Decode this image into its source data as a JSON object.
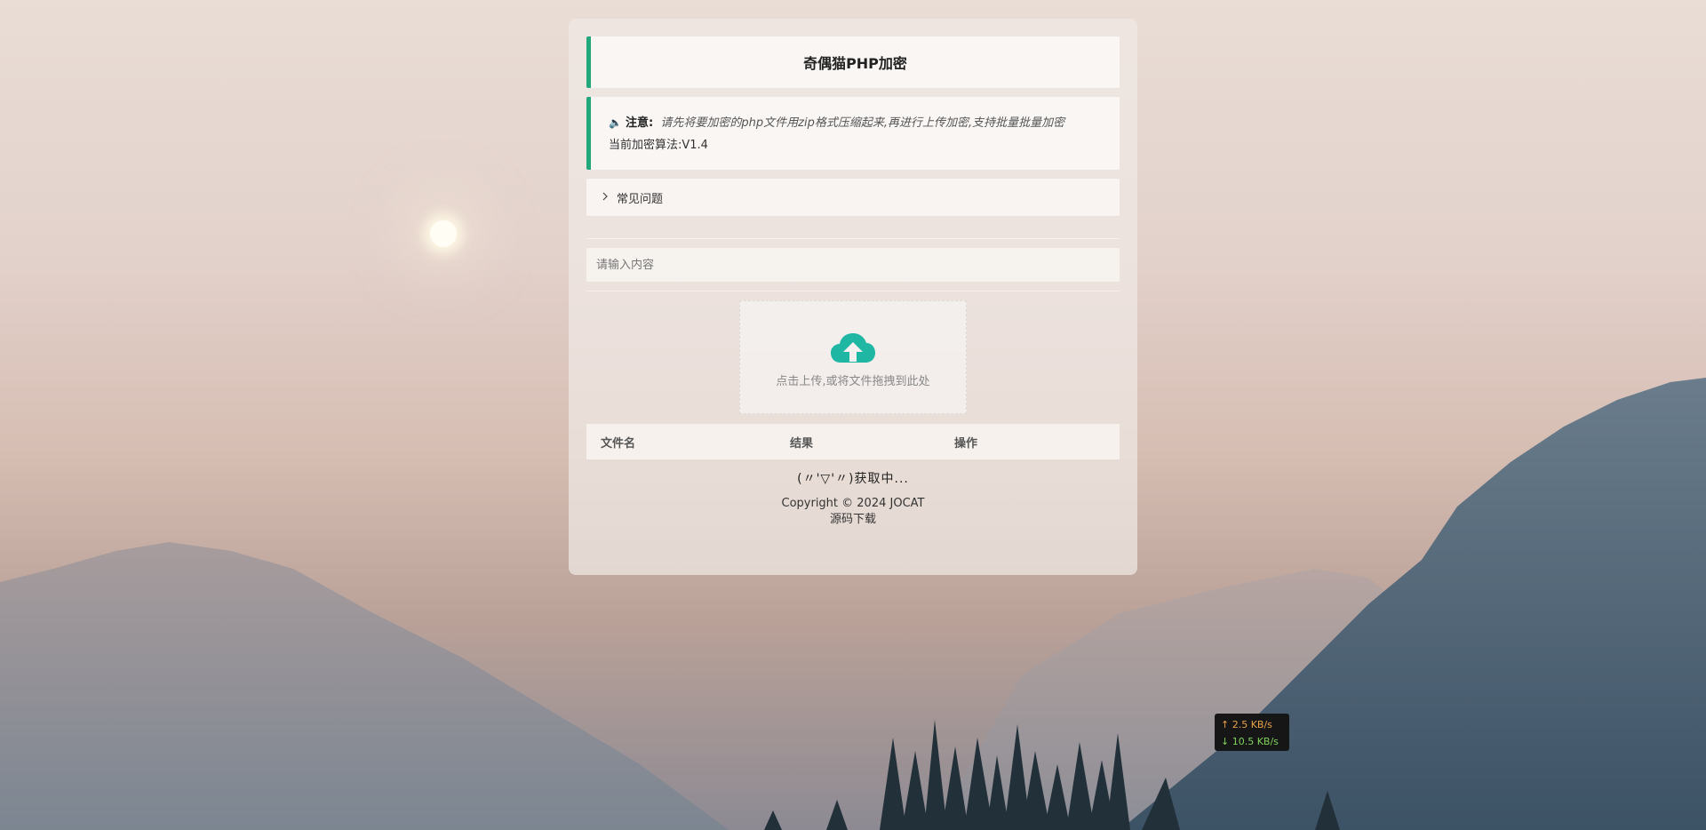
{
  "page": {
    "title": "奇偶猫PHP加密"
  },
  "notice": {
    "speaker_icon": "speaker-icon",
    "label": "注意:",
    "message": "请先将要加密的php文件用zip格式压缩起来,再进行上传加密,支持批量批量加密",
    "algorithm_label": "当前加密算法:",
    "algorithm_version": "V1.4"
  },
  "faq": {
    "label": "常见问题"
  },
  "search": {
    "placeholder": "请输入内容",
    "value": ""
  },
  "upload": {
    "hint": "点击上传,或将文件拖拽到此处",
    "icon_color": "#1fb7a4"
  },
  "table": {
    "columns": [
      "文件名",
      "结果",
      "操作"
    ]
  },
  "status": {
    "loading_text": "(〃'▽'〃)获取中..."
  },
  "footer": {
    "copyright": "Copyright © 2024 JOCAT",
    "source_link": "源码下载"
  },
  "netmon": {
    "upload_speed": "↑ 2.5 KB/s",
    "download_speed": "↓ 10.5 KB/s"
  },
  "colors": {
    "accent": "#21a77c",
    "upload_icon": "#1fb7a4"
  }
}
